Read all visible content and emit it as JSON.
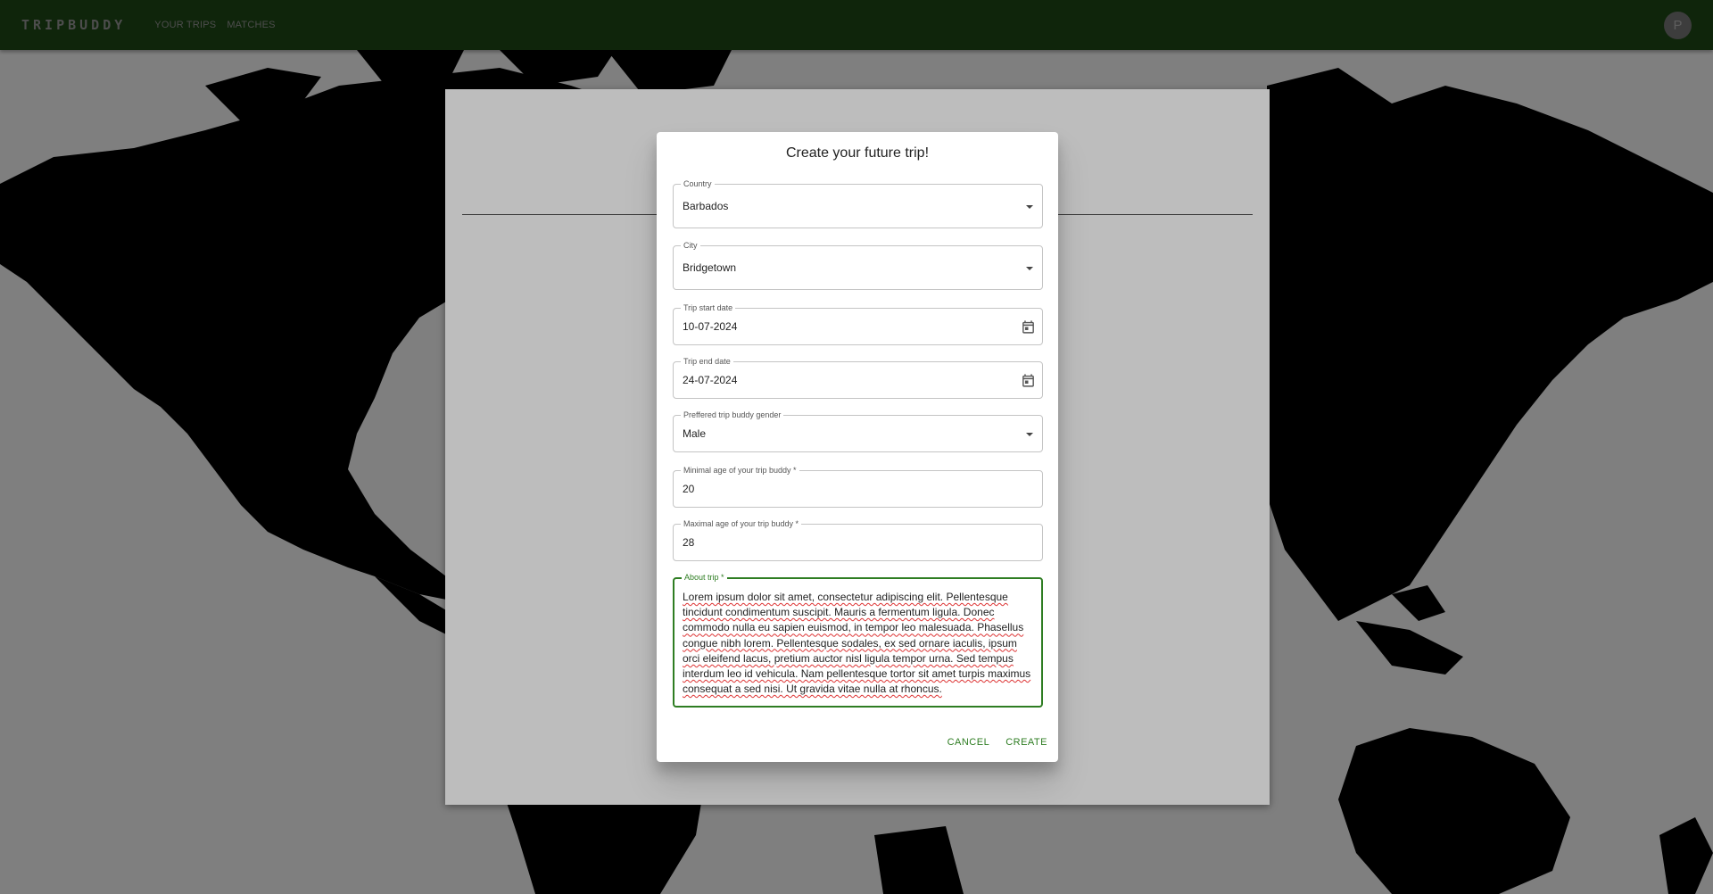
{
  "appbar": {
    "logo": "TRIPBUDDY",
    "nav": [
      "YOUR TRIPS",
      "MATCHES"
    ],
    "avatar_letter": "P"
  },
  "dialog": {
    "title": "Create your future trip!",
    "country": {
      "label": "Country",
      "value": "Barbados"
    },
    "city": {
      "label": "City",
      "value": "Bridgetown"
    },
    "start_date": {
      "label": "Trip start date",
      "value": "10-07-2024"
    },
    "end_date": {
      "label": "Trip end date",
      "value": "24-07-2024"
    },
    "gender": {
      "label": "Preffered trip buddy gender",
      "value": "Male"
    },
    "min_age": {
      "label": "Minimal age of your trip buddy *",
      "value": "20"
    },
    "max_age": {
      "label": "Maximal age of your trip buddy *",
      "value": "28"
    },
    "about": {
      "label": "About trip *",
      "value": "Lorem ipsum dolor sit amet, consectetur adipiscing elit. Pellentesque tincidunt condimentum suscipit. Mauris a fermentum ligula. Donec commodo nulla eu sapien euismod, in tempor leo malesuada. Phasellus congue nibh lorem. Pellentesque sodales, ex sed ornare iaculis, ipsum orci eleifend lacus, pretium auctor nisl ligula tempor urna. Sed tempus interdum leo id vehicula. Nam pellentesque tortor sit amet turpis maximus consequat a sed nisi. Ut gravida vitae nulla at rhoncus."
    },
    "cancel_label": "CANCEL",
    "create_label": "CREATE"
  },
  "colors": {
    "appbar": "#1f4a16",
    "accent": "#2e7d22"
  }
}
